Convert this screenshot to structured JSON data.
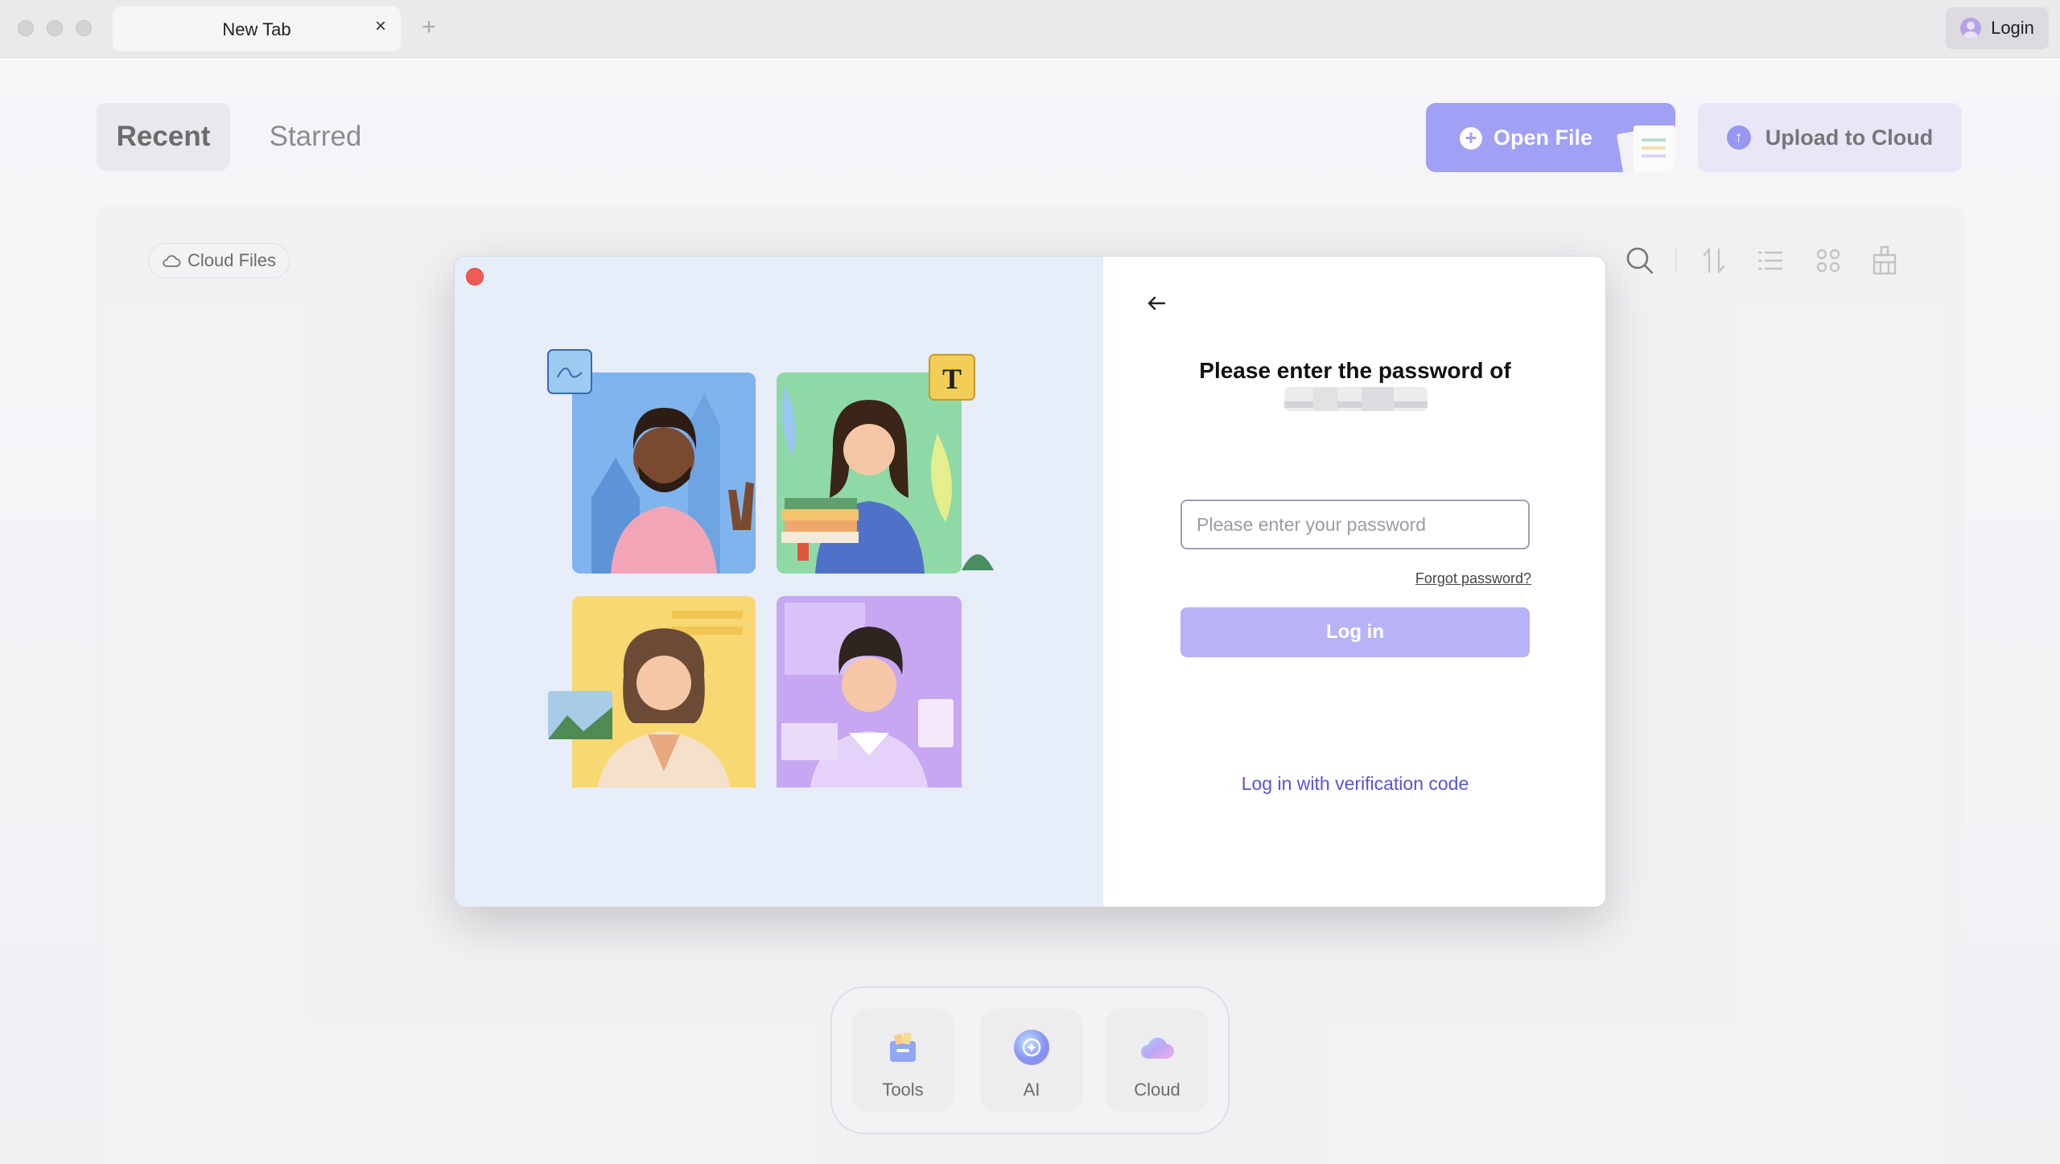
{
  "window": {
    "tab_title": "New Tab",
    "tab_close": "×",
    "new_tab": "+",
    "login_label": "Login"
  },
  "nav": {
    "recent": "Recent",
    "starred": "Starred"
  },
  "actions": {
    "open_file": "Open File",
    "upload": "Upload to Cloud"
  },
  "content": {
    "cloud_files": "Cloud Files",
    "toolbar_icons": [
      "search-icon",
      "sort-icon",
      "list-view-icon",
      "grid-view-icon",
      "clean-icon"
    ]
  },
  "dock": {
    "items": [
      {
        "label": "Tools",
        "icon": "tools-icon"
      },
      {
        "label": "AI",
        "icon": "ai-icon"
      },
      {
        "label": "Cloud",
        "icon": "cloud-icon"
      }
    ]
  },
  "dialog": {
    "title": "Please enter the password of",
    "password_placeholder": "Please enter your password",
    "forgot": "Forgot password?",
    "login_button": "Log in",
    "verification_link": "Log in with verification code"
  },
  "colors": {
    "accent": "#7273f5",
    "accent_light": "#e2dff8",
    "login_disabled": "#b8b3f6",
    "link": "#5655cf",
    "close_red": "#ee5b54"
  }
}
